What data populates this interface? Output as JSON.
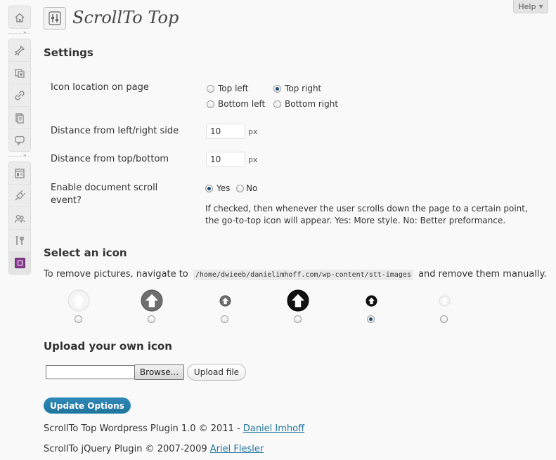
{
  "help": {
    "label": "Help"
  },
  "header": {
    "title": "ScrollTo Top"
  },
  "sidebar": {
    "top_items": [
      {
        "icon": "dashboard-icon"
      }
    ],
    "group1": [
      {
        "icon": "posts-icon"
      },
      {
        "icon": "media-icon"
      },
      {
        "icon": "links-icon"
      },
      {
        "icon": "pages-icon"
      },
      {
        "icon": "comments-icon"
      }
    ],
    "group2": [
      {
        "icon": "appearance-icon"
      },
      {
        "icon": "plugins-icon"
      },
      {
        "icon": "users-icon"
      },
      {
        "icon": "tools-icon"
      },
      {
        "icon": "settings-icon",
        "current": true
      }
    ]
  },
  "settings": {
    "heading": "Settings",
    "icon_location": {
      "label": "Icon location on page",
      "options": [
        "Top left",
        "Top right",
        "Bottom left",
        "Bottom right"
      ],
      "selected": "Top right"
    },
    "distance_side": {
      "label": "Distance from left/right side",
      "value": "10",
      "unit": "px"
    },
    "distance_top": {
      "label": "Distance from top/bottom",
      "value": "10",
      "unit": "px"
    },
    "scroll_event": {
      "label_line1": "Enable document scroll",
      "label_line2": "event?",
      "options": [
        "Yes",
        "No"
      ],
      "selected": "Yes",
      "description_line1": "If checked, then whenever the user scrolls down the page to a certain point,",
      "description_line2": "the go-to-top icon will appear. Yes: More style. No: Better preformance."
    }
  },
  "select_icon": {
    "heading": "Select an icon",
    "remove_text_before": "To remove pictures, navigate to",
    "path": "/home/dwieeb/danielimhoff.com/wp-content/stt-images",
    "remove_text_after": "and remove them manually.",
    "icons": [
      {
        "name": "white-large-up-arrow-icon",
        "style": "white",
        "size": 30
      },
      {
        "name": "gray-large-up-arrow-icon",
        "style": "gray",
        "size": 30
      },
      {
        "name": "gray-small-up-arrow-icon",
        "style": "gray",
        "size": 15
      },
      {
        "name": "black-large-up-arrow-icon",
        "style": "black",
        "size": 30
      },
      {
        "name": "black-small-up-arrow-icon",
        "style": "black",
        "size": 15
      },
      {
        "name": "white-small-up-arrow-icon",
        "style": "white",
        "size": 15
      }
    ],
    "selected_index": 4
  },
  "upload": {
    "heading": "Upload your own icon",
    "browse_label": "Browse...",
    "upload_label": "Upload file"
  },
  "actions": {
    "update_label": "Update Options"
  },
  "footer": {
    "line1_text": "ScrollTo Top Wordpress Plugin 1.0 © 2011 - ",
    "line1_link": "Daniel Imhoff",
    "line2_text": "ScrollTo jQuery Plugin © 2007-2009 ",
    "line2_link": "Ariel Flesler"
  },
  "colors": {
    "accent": "#21759b",
    "radio_checked": "#1e4f7b",
    "settings_menu": "#8a3c93"
  }
}
